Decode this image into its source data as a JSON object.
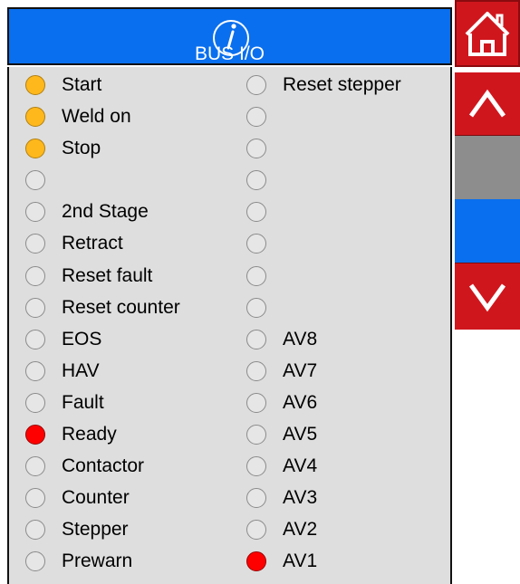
{
  "header": {
    "title": "BUS I/O"
  },
  "colors": {
    "header_blue": "#0a6fee",
    "button_red": "#d0161d",
    "lamp_amber": "#ffb81c",
    "lamp_red": "#ff0000",
    "lamp_off": "#e6e6e6",
    "panel_bg": "#dedede",
    "scroll_gray": "#8d8d8d"
  },
  "icons": {
    "info": "info-icon",
    "home": "home-icon",
    "up": "chevron-up-icon",
    "down": "chevron-down-icon"
  },
  "inputs_left": [
    {
      "label": "Start",
      "state": "amber"
    },
    {
      "label": "Weld on",
      "state": "amber"
    },
    {
      "label": "Stop",
      "state": "amber"
    },
    {
      "label": "",
      "state": "off"
    },
    {
      "label": "2nd Stage",
      "state": "off"
    },
    {
      "label": "Retract",
      "state": "off"
    },
    {
      "label": "Reset fault",
      "state": "off"
    },
    {
      "label": "Reset counter",
      "state": "off"
    },
    {
      "label": "EOS",
      "state": "off"
    },
    {
      "label": "HAV",
      "state": "off"
    },
    {
      "label": "Fault",
      "state": "off"
    },
    {
      "label": "Ready",
      "state": "red"
    },
    {
      "label": "Contactor",
      "state": "off"
    },
    {
      "label": "Counter",
      "state": "off"
    },
    {
      "label": "Stepper",
      "state": "off"
    },
    {
      "label": "Prewarn",
      "state": "off"
    }
  ],
  "inputs_right": [
    {
      "label": "Reset stepper",
      "state": "off"
    },
    {
      "label": "",
      "state": "off"
    },
    {
      "label": "",
      "state": "off"
    },
    {
      "label": "",
      "state": "off"
    },
    {
      "label": "",
      "state": "off"
    },
    {
      "label": "",
      "state": "off"
    },
    {
      "label": "",
      "state": "off"
    },
    {
      "label": "",
      "state": "off"
    },
    {
      "label": "AV8",
      "state": "off"
    },
    {
      "label": "AV7",
      "state": "off"
    },
    {
      "label": "AV6",
      "state": "off"
    },
    {
      "label": "AV5",
      "state": "off"
    },
    {
      "label": "AV4",
      "state": "off"
    },
    {
      "label": "AV3",
      "state": "off"
    },
    {
      "label": "AV2",
      "state": "off"
    },
    {
      "label": "AV1",
      "state": "red"
    }
  ]
}
